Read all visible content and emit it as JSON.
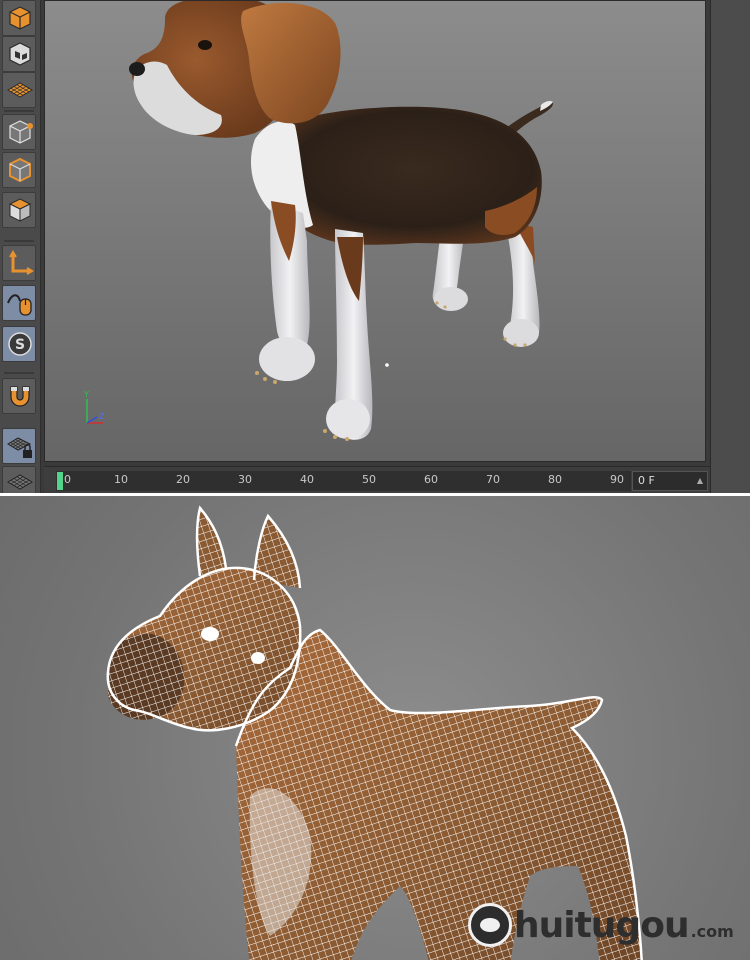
{
  "toolbar": {
    "tools": [
      {
        "name": "cube-object-icon"
      },
      {
        "name": "checker-cube-icon"
      },
      {
        "name": "grid-plane-icon"
      },
      {
        "name": "points-mode-icon"
      },
      {
        "name": "edges-mode-icon"
      },
      {
        "name": "polygons-mode-icon"
      },
      {
        "name": "axis-mode-icon"
      },
      {
        "name": "tweak-mode-icon"
      },
      {
        "name": "snap-s-icon"
      },
      {
        "name": "magnet-icon"
      },
      {
        "name": "locked-grid-icon"
      },
      {
        "name": "grid-icon"
      }
    ],
    "snap_letter": "S"
  },
  "viewport": {
    "axis": {
      "y": "Y",
      "z": "Z"
    }
  },
  "timeline": {
    "ticks": [
      "0",
      "10",
      "20",
      "30",
      "40",
      "50",
      "60",
      "70",
      "80",
      "90"
    ],
    "current_frame": "0 F"
  },
  "watermark": {
    "brand": "huitugou",
    "domain": ".com"
  },
  "colors": {
    "tool_accent": "#e8922f",
    "timeline_marker": "#55d38c",
    "wireframe": "#ffffff"
  }
}
